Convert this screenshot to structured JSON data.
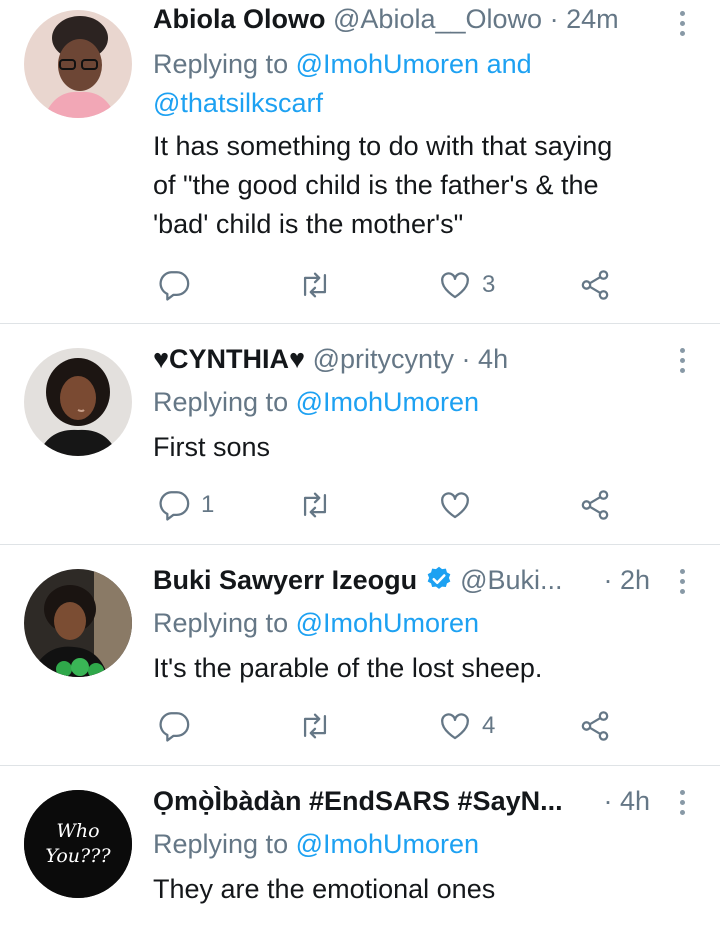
{
  "tweets": [
    {
      "name": "Abiola Olowo",
      "handle": "@Abiola__Olowo",
      "sep": "·",
      "time": "24m",
      "replying_prefix": "Replying to ",
      "mention1": "@ImohUmoren",
      "replying_and": " and",
      "mention2": "@thatsilkscarf",
      "text_lines": [
        "It has something to do with that saying",
        "of \"the good child is the father's & the",
        "'bad' child is the mother's\""
      ],
      "reply_count": "",
      "like_count": "3"
    },
    {
      "name": "♥CYNTHIA♥",
      "handle": "@pritycynty",
      "sep": "·",
      "time": "4h",
      "replying_prefix": "Replying to ",
      "mention1": "@ImohUmoren",
      "text_lines": [
        "First sons"
      ],
      "reply_count": "1",
      "like_count": ""
    },
    {
      "name": "Buki Sawyerr Izeogu",
      "handle": "@Buki...",
      "sep": "·",
      "time": "2h",
      "replying_prefix": "Replying to ",
      "mention1": "@ImohUmoren",
      "text_lines": [
        "It's the parable of the lost sheep."
      ],
      "reply_count": "",
      "like_count": "4"
    },
    {
      "name": "Ọmọ̀Ìbàdàn #EndSARS #SayN...",
      "sep": "·",
      "time": "4h",
      "replying_prefix": "Replying to ",
      "mention1": "@ImohUmoren",
      "text_lines": [
        "They are the emotional ones"
      ],
      "avatar_text": [
        "Who",
        "You???"
      ]
    }
  ],
  "colors": {
    "accent": "#1da1f2",
    "secondary_text": "#657786",
    "divider": "#dfe3e6"
  },
  "icons": [
    "reply-icon",
    "retweet-icon",
    "like-icon",
    "share-icon",
    "more-icon",
    "verified-icon"
  ]
}
